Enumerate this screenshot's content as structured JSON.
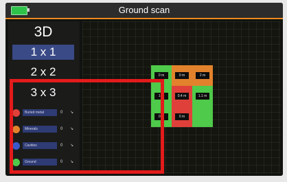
{
  "window": {
    "title": "Ground scan"
  },
  "battery": {
    "color": "#2ec24a"
  },
  "modes": [
    {
      "label": "3D",
      "active": false
    },
    {
      "label": "1 x 1",
      "active": true
    },
    {
      "label": "2 x 2",
      "active": false
    },
    {
      "label": "3 x 3",
      "active": false
    }
  ],
  "legend": [
    {
      "label": "Buried metal",
      "count": "0",
      "color": "#e0403a"
    },
    {
      "label": "Minerals",
      "count": "0",
      "color": "#e2822c"
    },
    {
      "label": "Cavities",
      "count": "0",
      "color": "#3b59c8"
    },
    {
      "label": "Ground",
      "count": "0",
      "color": "#4fca4a"
    }
  ],
  "grid": {
    "cells": [
      {
        "type": "ground",
        "label": "0 m"
      },
      {
        "type": "minerals",
        "label": "0 m"
      },
      {
        "type": "minerals",
        "label": "2 m"
      },
      {
        "type": "ground",
        "label": "1 m"
      },
      {
        "type": "buried-metal",
        "label": "0.4 m"
      },
      {
        "type": "ground",
        "label": "1.1 m"
      },
      {
        "type": "ground",
        "label": "0 m"
      },
      {
        "type": "buried-metal",
        "label": "0 m"
      },
      {
        "type": "ground",
        "label": ""
      }
    ]
  },
  "highlight_color": "#e21b1b"
}
